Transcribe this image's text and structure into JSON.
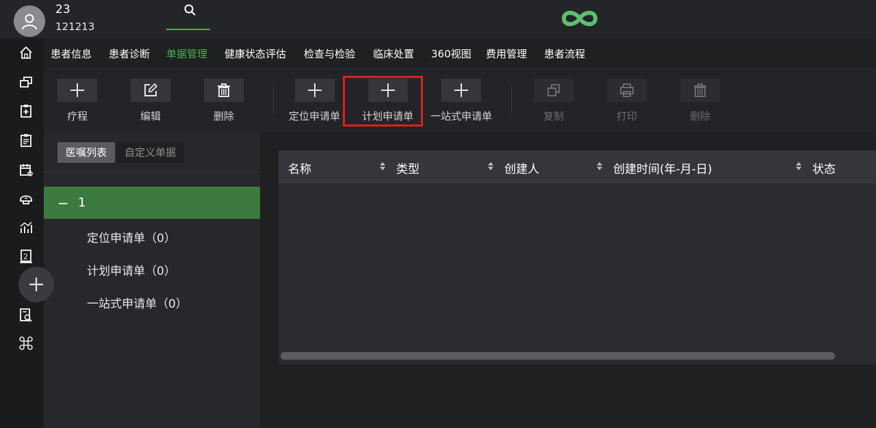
{
  "header": {
    "patient_name": "23",
    "patient_id": "121213"
  },
  "nav": {
    "tabs": [
      {
        "label": "患者信息"
      },
      {
        "label": "患者诊断"
      },
      {
        "label": "单据管理"
      },
      {
        "label": "健康状态评估"
      },
      {
        "label": "检查与检验"
      },
      {
        "label": "临床处置"
      },
      {
        "label": "360视图"
      },
      {
        "label": "费用管理"
      },
      {
        "label": "患者流程"
      }
    ],
    "active_tab": "单据管理"
  },
  "toolbar": {
    "course_label": "疗程",
    "edit_label": "编辑",
    "delete_label": "删除",
    "locate_request_label": "定位申请单",
    "plan_request_label": "计划申请单",
    "onestop_request_label": "一站式申请单",
    "copy_label": "复制",
    "print_label": "打印",
    "delete2_label": "删除"
  },
  "left_panel": {
    "subtabs": [
      {
        "label": "医嘱列表"
      },
      {
        "label": "自定义单据"
      }
    ],
    "tree": {
      "root_label": "1",
      "items": [
        {
          "label": "定位申请单（0）"
        },
        {
          "label": "计划申请单（0）"
        },
        {
          "label": "一站式申请单（0）"
        }
      ]
    }
  },
  "table": {
    "columns": [
      {
        "label": "名称"
      },
      {
        "label": "类型"
      },
      {
        "label": "创建人"
      },
      {
        "label": "创建时间(年-月-日)"
      },
      {
        "label": "状态"
      }
    ],
    "rows": []
  },
  "colors": {
    "accent": "#4caf50",
    "tree_selected": "#3d7a3f",
    "highlight_box": "#e01e1e",
    "logo": "#5cbf6e"
  },
  "icons": {
    "rail": [
      "home-icon",
      "windows-icon",
      "clipboard-plus-icon",
      "clipboard-list-icon",
      "calendar-icon",
      "helmet-icon",
      "chart-icon",
      "document-2-icon",
      "document-search-icon",
      "command-icon"
    ],
    "fab": "plus-icon"
  }
}
